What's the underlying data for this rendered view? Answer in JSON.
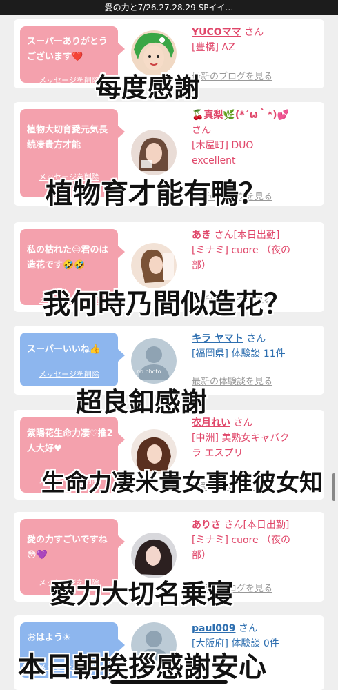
{
  "status_bar": {
    "title": "愛の力と7/26.27.28.29 SPイイ…"
  },
  "cards": [
    {
      "bubble_color": "pink",
      "message": "スーパーありがとうございます❤️",
      "link": "メッセージを削除",
      "name": "YUCOママ",
      "suffix": "さん",
      "status": "",
      "area_lines": [
        "[豊橋] AZ"
      ],
      "blog_link": "最新のブログを見る",
      "avatar": "green-hair-illustration-avatar"
    },
    {
      "bubble_color": "pink",
      "message": "植物大切育愛元気長続凄貴方才能",
      "link": "メッセージを削除",
      "name": "🍒真梨🌿(*´ω｀*)💕",
      "suffix": "さん",
      "status": "",
      "area_lines": [
        "[木屋町] DUO",
        "excellent"
      ],
      "blog_link": "最新のブログを見る",
      "avatar": "woman-photo-avatar"
    },
    {
      "bubble_color": "pink",
      "message": "私の枯れた😑君のは造花です🤣🤣",
      "link": "メッセージを削除",
      "name": "あき",
      "suffix": "さん",
      "status": "[本日出勤]",
      "area_lines": [
        "[ミナミ] cuore （夜の",
        "部）"
      ],
      "blog_link": "最新のブログを見る",
      "avatar": "woman-photo-avatar"
    },
    {
      "bubble_color": "blue",
      "message": "スーパーいいね👍",
      "link": "メッセージを削除",
      "name": "キラ ヤマト",
      "suffix": "さん",
      "status": "",
      "area_lines": [
        "[福岡県] 体験談 11件"
      ],
      "blog_link": "最新の体験談を見る",
      "avatar": "no-photo-avatar",
      "no_photo_label": "no photo"
    },
    {
      "bubble_color": "pink",
      "message": "紫陽花生命力凄♡推2人大好♥",
      "link": "メッセージを削除",
      "name": "衣月れい",
      "suffix": "さん",
      "status": "",
      "area_lines": [
        "[中洲] 美熟女キャバク",
        "ラ エスプリ"
      ],
      "blog_link": "最新のブログを見る",
      "avatar": "woman-photo-avatar"
    },
    {
      "bubble_color": "pink",
      "message": "愛の力すごいですね😳💜",
      "link": "メッセージを削除",
      "name": "ありさ",
      "suffix": "さん",
      "status": "[本日出勤]",
      "area_lines": [
        "[ミナミ] cuore （夜の",
        "部）"
      ],
      "blog_link": "最新のブログを見る",
      "avatar": "woman-photo-avatar"
    },
    {
      "bubble_color": "blue",
      "message": "おはよう☀",
      "link": "メッセージを削除",
      "name": "paul009",
      "suffix": "さん",
      "status": "",
      "area_lines": [
        "[大阪府] 体験談 0件"
      ],
      "blog_link": "",
      "avatar": "no-photo-avatar",
      "no_photo_label": ""
    }
  ],
  "overlays": [
    "每度感謝",
    "植物育才能有鴨？",
    "我何時乃間似造花？",
    "超良釦感謝",
    "生命力凄米貴女事推彼女知",
    "愛力大切名乗寝",
    "本日朝挨拶感謝安心"
  ],
  "colors": {
    "pink_bubble": "#f4a1ad",
    "blue_bubble": "#8db6ee",
    "pink_text": "#e0476a",
    "blue_text": "#2e6fb0"
  }
}
